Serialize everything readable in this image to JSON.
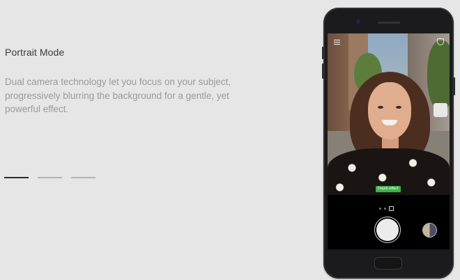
{
  "feature": {
    "title": "Portrait Mode",
    "description": "Dual camera technology let you focus on your subject, progressively blurring the background for a gentle, yet powerful effect."
  },
  "pager": {
    "count": 3,
    "active_index": 0
  },
  "camera_app": {
    "badge_label": "Depth effect",
    "icons": [
      "menu-icon",
      "camera-mode-icon",
      "shutter-button",
      "switch-camera-icon"
    ],
    "mode_dots": 3,
    "badge_color": "#3fb14c"
  }
}
